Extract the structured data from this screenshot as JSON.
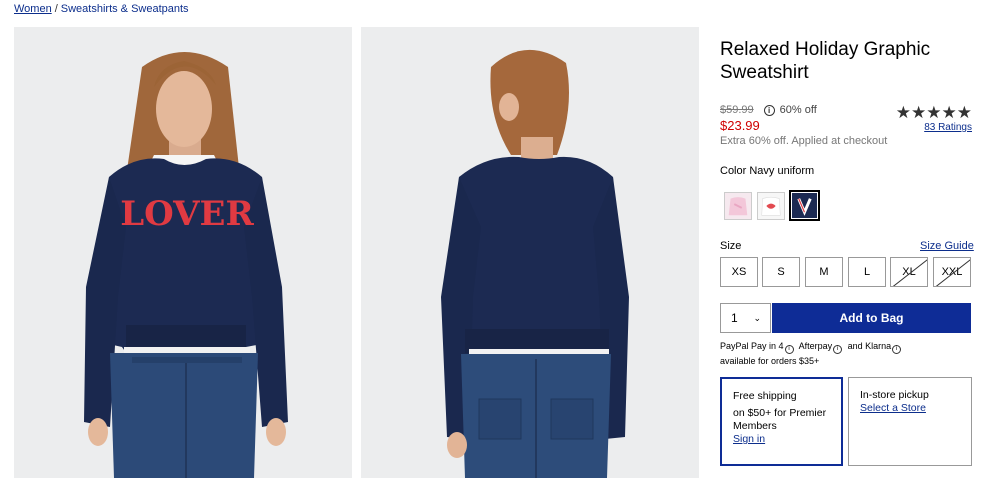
{
  "breadcrumb": {
    "item1": "Women",
    "separator": "/",
    "item2": "Sweatshirts & Sweatpants"
  },
  "images": {
    "front_graphic_text": "LOVER"
  },
  "product": {
    "title": "Relaxed Holiday Graphic Sweatshirt",
    "original_price": "$59.99",
    "discount": "60% off",
    "sale_price": "$23.99",
    "extra_offer": "Extra 60% off. Applied at checkout",
    "stars": "★★★★★",
    "rating_value": 5,
    "ratings_link": "83 Ratings"
  },
  "color": {
    "label": "Color Navy uniform",
    "swatch_count": 3,
    "selected_index": 3
  },
  "size": {
    "label": "Size",
    "guide": "Size Guide",
    "options": [
      {
        "label": "XS",
        "available": true
      },
      {
        "label": "S",
        "available": true
      },
      {
        "label": "M",
        "available": true
      },
      {
        "label": "L",
        "available": true
      },
      {
        "label": "XL",
        "available": false
      },
      {
        "label": "XXL",
        "available": false
      }
    ]
  },
  "cart": {
    "quantity": "1",
    "quantity_chevron": "⌄",
    "add_label": "Add to Bag"
  },
  "bnpl": {
    "paypal": "PayPal Pay in 4",
    "afterpay": "Afterpay",
    "and": "and",
    "klarna": "Klarna",
    "info_glyph": "i",
    "line2": "available for orders $35+"
  },
  "fulfillment": {
    "ship_title": "Free shipping",
    "ship_text": "on $50+ for Premier Members",
    "ship_link": "Sign in",
    "pickup_title": "In-store pickup",
    "pickup_link": "Select a Store"
  },
  "colors": {
    "accent": "#0e2c96",
    "sale": "#d00000",
    "link": "#0c2e8c",
    "garment": "#1c2a52"
  }
}
